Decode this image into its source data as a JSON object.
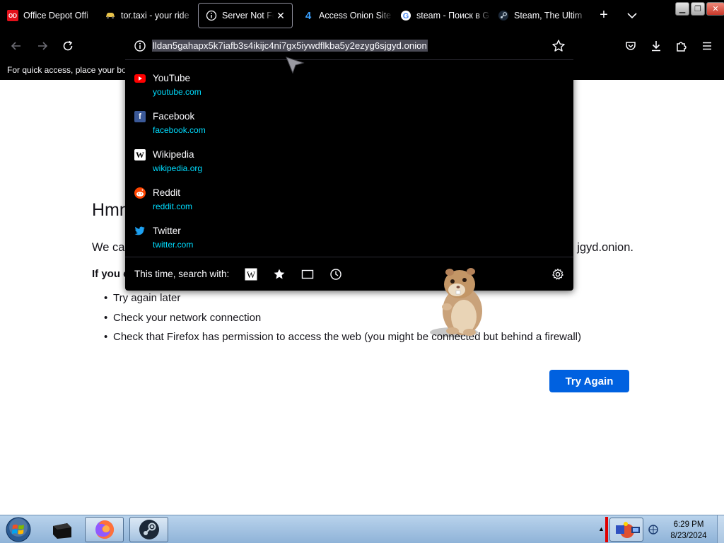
{
  "tabs": [
    {
      "label": "Office Depot Offi",
      "icon": "office-depot-icon",
      "active": false
    },
    {
      "label": "tor.taxi - your ride",
      "icon": "taxi-icon",
      "active": false
    },
    {
      "label": "Server Not Foun",
      "icon": "info-icon",
      "active": true
    },
    {
      "label": "Access Onion Site",
      "icon": "onion-4-icon",
      "active": false
    },
    {
      "label": "steam - Поиск в G",
      "icon": "google-icon",
      "active": false
    },
    {
      "label": "Steam, The Ultim",
      "icon": "steam-icon",
      "active": false
    }
  ],
  "bookmarks_hint": "For quick access, place your boo",
  "urlbar": {
    "value": "lldan5gahapx5k7iafb3s4ikijc4ni7gx5iywdflkba5y2ezyg6sjgyd.onion"
  },
  "suggestions": [
    {
      "title": "YouTube",
      "url": "youtube.com",
      "icon": "youtube-icon",
      "color": "#ff0000"
    },
    {
      "title": "Facebook",
      "url": "facebook.com",
      "icon": "facebook-icon",
      "color": "#1877f2"
    },
    {
      "title": "Wikipedia",
      "url": "wikipedia.org",
      "icon": "wikipedia-icon",
      "color": "#ffffff"
    },
    {
      "title": "Reddit",
      "url": "reddit.com",
      "icon": "reddit-icon",
      "color": "#ff4500"
    },
    {
      "title": "Twitter",
      "url": "twitter.com",
      "icon": "twitter-icon",
      "color": "#1da1f2"
    }
  ],
  "search_with_label": "This time, search with:",
  "error": {
    "title_visible": "Hmm",
    "desc_start": "We ca",
    "desc_end": "jgyd.onion.",
    "bold_start": "If you e",
    "items": [
      "Try again later",
      "Check your network connection",
      "Check that Firefox has permission to access the web (you might be connected but behind a firewall)"
    ],
    "button": "Try Again"
  },
  "clock": {
    "time": "6:29 PM",
    "date": "8/23/2024"
  },
  "colors": {
    "accent": "#0061e0",
    "suggestion_url": "#00ddff"
  }
}
